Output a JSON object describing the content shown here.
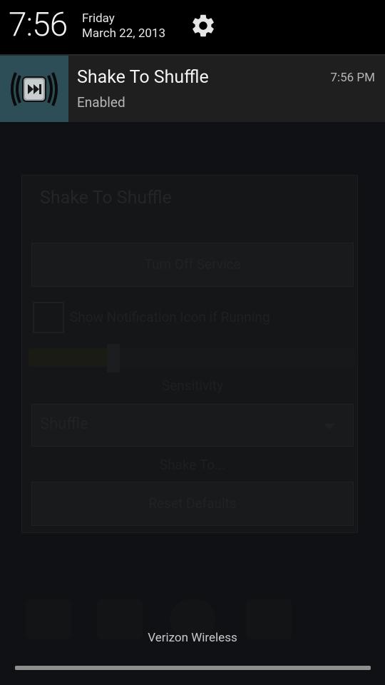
{
  "status": {
    "time": "7:56",
    "day": "Friday",
    "date": "March 22, 2013",
    "settings_icon": "gear-icon"
  },
  "notification": {
    "app_icon": "shake-speaker-icon",
    "title": "Shake To Shuffle",
    "subtitle": "Enabled",
    "time": "7:56 PM"
  },
  "background_app": {
    "title": "Shake To Shuffle",
    "turn_off_button": "Turn Off Service",
    "checkbox_label": "Show Notification Icon if Running",
    "checkbox_checked": true,
    "sensitivity_label": "Sensitivity",
    "sensitivity_fraction": 0.26,
    "select_value": "Shuffle",
    "select_label": "Shake To...",
    "reset_button": "Reset Defaults"
  },
  "carrier": "Verizon Wireless",
  "colors": {
    "accent": "#2d4d57",
    "header_bg": "#000000",
    "notification_bg": "#1f1f1f"
  }
}
